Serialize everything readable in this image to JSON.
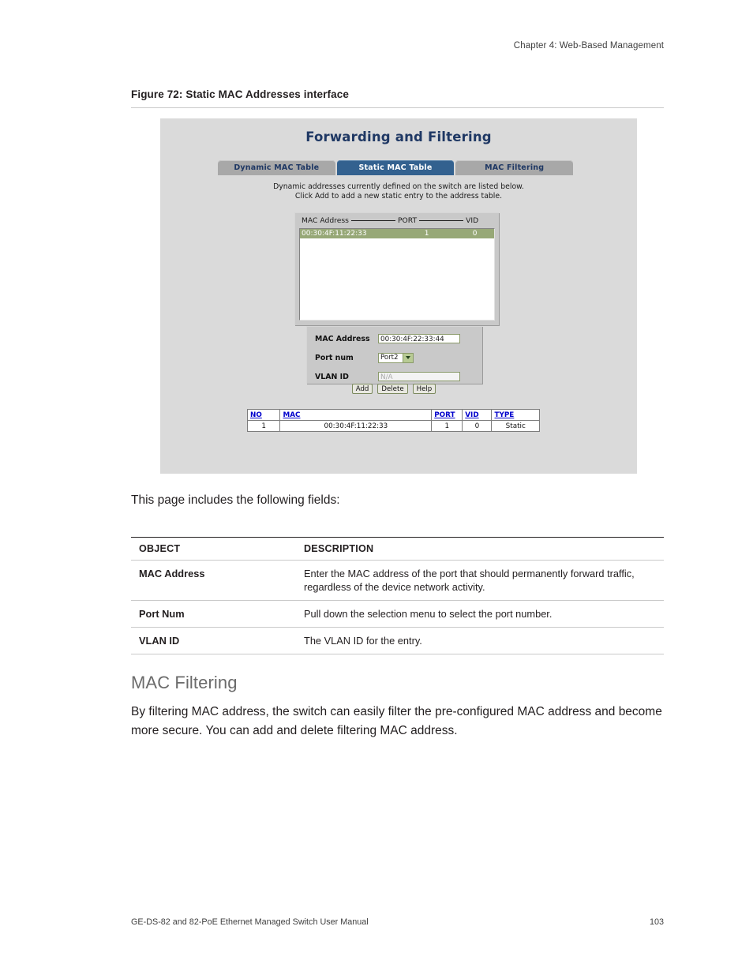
{
  "running_head": "Chapter 4: Web-Based Management",
  "figure": {
    "caption": "Figure 72: Static MAC Addresses interface",
    "screenshot": {
      "title": "Forwarding and Filtering",
      "tabs": [
        {
          "label": "Dynamic MAC Table",
          "active": false
        },
        {
          "label": "Static MAC Table",
          "active": true
        },
        {
          "label": "MAC Filtering",
          "active": false
        }
      ],
      "description_line1": "Dynamic addresses currently defined on the switch are listed below.",
      "description_line2": "Click Add to add a new static entry to the address table.",
      "listbox": {
        "header_mac": "MAC Address",
        "header_port": "PORT",
        "header_vid": "VID",
        "rows": [
          {
            "mac": "00:30:4F:11:22:33",
            "port": "1",
            "vid": "0"
          }
        ]
      },
      "form": {
        "mac_label": "MAC Address",
        "mac_value": "00:30:4F:22:33:44",
        "port_label": "Port num",
        "port_value": "Port2",
        "vlan_label": "VLAN ID",
        "vlan_placeholder": "N/A"
      },
      "buttons": {
        "add": "Add",
        "delete": "Delete",
        "help": "Help"
      },
      "grid": {
        "headers": [
          "NO",
          "MAC",
          "PORT",
          "VID",
          "TYPE"
        ],
        "rows": [
          [
            "1",
            "00:30:4F:11:22:33",
            "1",
            "0",
            "Static"
          ]
        ]
      },
      "colors": {
        "panel_bg": "#dadada",
        "title": "#1f3864",
        "tab_active_bg": "#33618f",
        "tab_inactive_bg": "#a8a8a8",
        "selected_row_bg": "#97a877",
        "link_blue": "#0000cc"
      }
    }
  },
  "lead_text": "This page includes the following fields:",
  "fields_table": {
    "headers": {
      "object": "OBJECT",
      "description": "DESCRIPTION"
    },
    "rows": [
      {
        "object": "MAC Address",
        "description": "Enter the MAC address of the port that should permanently forward traffic, regardless of the device network activity."
      },
      {
        "object": "Port Num",
        "description": "Pull down the selection menu to select the port number."
      },
      {
        "object": "VLAN ID",
        "description": "The VLAN ID for the entry."
      }
    ]
  },
  "section": {
    "heading": "MAC Filtering",
    "paragraph": "By filtering MAC address, the switch can easily filter the pre-configured MAC address and become more secure. You can add and delete filtering MAC address."
  },
  "footer": {
    "left": "GE-DS-82 and 82-PoE Ethernet Managed Switch User Manual",
    "page": "103"
  }
}
